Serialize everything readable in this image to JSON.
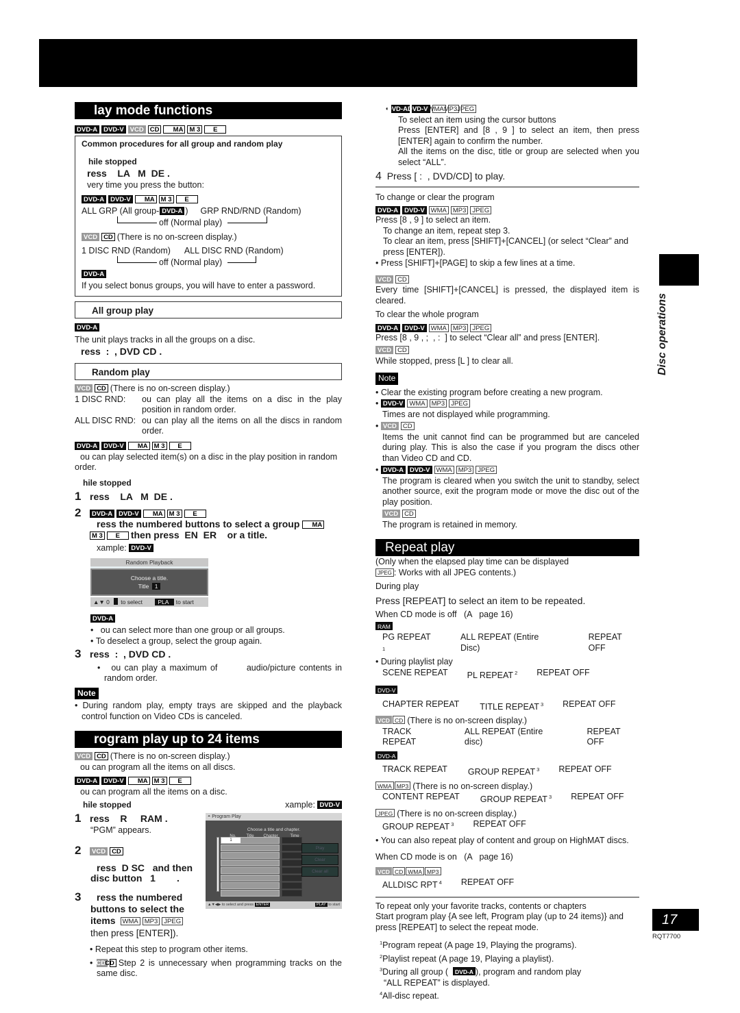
{
  "page": {
    "number": "17",
    "code": "RQT7700",
    "side_tab": "Disc operations"
  },
  "tags": {
    "dvda": "DVD-A",
    "dvdv": "DVD-V",
    "vcd": "VCD",
    "cd": "CD",
    "wma_trunc": "MA",
    "mp3_trunc": "M 3",
    "jpeg_trunc": "E",
    "wma": "WMA",
    "mp3": "MP3",
    "jpeg": "JPEG",
    "ram": "RAM"
  },
  "left": {
    "play_mode": {
      "title": "lay mode functions",
      "common_title": "Common procedures for all group and random play",
      "while_stopped": "hile stopped",
      "press_play_mode": "ress    LA   M  DE .",
      "every_time": "very time you press the button:",
      "seq1_a": "ALL GRP (All group-",
      "seq1_b": ")",
      "seq1_c": "GRP RND/RND (Random)",
      "seq1_off": "off (Normal play)",
      "vcd_no_display": "(There is no on-screen display.)",
      "seq2_a": "1 DISC RND (Random)",
      "seq2_b": "ALL DISC RND (Random)",
      "seq2_off": "off (Normal play)",
      "password_note": "If you select bonus groups, you will have to enter a password."
    },
    "all_group": {
      "title": "All group play",
      "desc": "The unit plays tracks in all the groups on a disc.",
      "press": "ress  :  , DVD CD ."
    },
    "random": {
      "title": "Random play",
      "vcd_no_display": "(There is no on-screen display.)",
      "disc1_key": "1 DISC RND:",
      "disc1_val": "ou can play all the items on a disc in the play position in random order.",
      "alldisc_key": "ALL DISC RND:",
      "alldisc_val": "ou can play all the items on all the discs in random order.",
      "selected_desc": "ou can play selected item(s) on a disc in the play position in random order.",
      "while_stopped": "hile stopped",
      "step1": "ress    LA   M  DE .",
      "step2_a": "ress the numbered buttons to select a group",
      "step2_b": "then press  EN  ER    or a title.",
      "example": "xample:",
      "screen_title": "Random Playback",
      "screen_prompt": "Choose a title.",
      "screen_field_label": "Title",
      "screen_field_value": "1",
      "screen_keys": "▲▼ 0",
      "screen_to_select": "to select",
      "screen_play": "PLA",
      "screen_to_start": "to start",
      "dvda_b1": "ou can select more than one group or all groups.",
      "dvda_b2": "To deselect a group, select the group again.",
      "step3": "ress  :  , DVD CD .",
      "step3_b1": "ou can play a maximum of        audio/picture contents in random order.",
      "note_label": "Note",
      "note_b1": "During random play, empty trays are skipped and the playback control function on Video CDs is canceled."
    },
    "program": {
      "title": "rogram play  up to 24 items",
      "vcd_no_display": "(There is no on-screen display.)",
      "vcd_desc": "ou can program all the items on all discs.",
      "dvd_desc": "ou can program all the items on a disc.",
      "while_stopped": "hile stopped",
      "example": "xample:",
      "step1": "ress    R     RAM .",
      "step1_sub": "“PGM” appears.",
      "step2_a": "ress  D SC   and then",
      "step2_b": "disc button   1        .",
      "step3_a": "ress the numbered",
      "step3_b": "buttons to select the",
      "step3_c": "items",
      "step3_d": "then press [ENTER]).",
      "b1": "Repeat this step to program other items.",
      "b2": "Step 2 is unnecessary when programming tracks on the same disc.",
      "screen": {
        "title": "Program Play",
        "prompt": "Choose a title and chapter.",
        "cols": [
          "No.",
          "Title",
          "Chapter",
          "Time"
        ],
        "first_no": "1",
        "buttons": [
          "Play",
          "Clear",
          "Clear all"
        ],
        "footer_left": "▲▼◀▶ to select and press",
        "footer_enter": "ENTER",
        "footer_play": "PLAY",
        "footer_right": "to start"
      }
    }
  },
  "right": {
    "cursor": {
      "l1": "To select an item using the cursor buttons",
      "l2": "Press [ENTER] and [8 , 9 ] to select an item, then press [ENTER] again to confirm the number.",
      "l3": "All the items on the disc, title or group are selected when you select “ALL”."
    },
    "step4_num": "4",
    "step4": "Press [ :  , DVD/CD] to play.",
    "change": {
      "heading": "To change or clear the program",
      "l1": "Press [8 , 9 ] to select an item.",
      "l2": "To change an item, repeat step 3.",
      "l3": "To clear an item, press [SHIFT]+[CANCEL] (or select “Clear” and press [ENTER]).",
      "b1": "Press [SHIFT]+[PAGE] to skip a few lines at a time.",
      "vcd_l1": "Every time [SHIFT]+[CANCEL] is pressed, the displayed item is cleared."
    },
    "clear_all": {
      "heading": "To clear the whole program",
      "l1": "Press [8 , 9 , ;  , :  ] to select “Clear all” and press [ENTER].",
      "vcd_l1": "While stopped, press [L ] to clear all."
    },
    "note": {
      "label": "Note",
      "b1": "Clear the existing program before creating a new program.",
      "b2": "Times are not displayed while programming.",
      "b3": "Items the unit cannot find can be programmed but are canceled during play. This is also the case if you program the discs other than Video CD and CD.",
      "b4": "The program is cleared when you switch the unit to standby, select another source, exit the program mode or move the disc out of the play position.",
      "b4_vcd": "The program is retained in memory."
    },
    "repeat": {
      "title": "Repeat play",
      "only_when": "(Only when the elapsed play time can be displayed",
      "jpeg_works": ": Works with all JPEG contents.)",
      "during_play": "During play",
      "press": "Press [REPEAT] to select an item to be repeated.",
      "cd_off": "When CD mode is off   (A   page 16)",
      "ram_seq": [
        "PG REPEAT",
        "ALL REPEAT (Entire Disc)",
        "REPEAT OFF"
      ],
      "ram_seq_sup": "1",
      "playlist_bullet": "During playlist play",
      "playlist_seq": [
        "SCENE REPEAT",
        "PL REPEAT",
        "REPEAT OFF"
      ],
      "playlist_sup": "2",
      "dvdv_seq": [
        "CHAPTER REPEAT",
        "TITLE REPEAT",
        "REPEAT OFF"
      ],
      "dvdv_sup": "3",
      "vcd_no_display": "(There is no on-screen display.)",
      "vcd_seq": [
        "TRACK REPEAT",
        "ALL REPEAT (Entire disc)",
        "REPEAT OFF"
      ],
      "dvda_seq": [
        "TRACK REPEAT",
        "GROUP REPEAT",
        "REPEAT OFF"
      ],
      "dvda_sup": "3",
      "wma_no_display": "(There is no on-screen display.)",
      "wma_seq": [
        "CONTENT REPEAT",
        "GROUP REPEAT",
        "REPEAT OFF"
      ],
      "wma_sup": "3",
      "jpeg_no_display": "(There is no on-screen display.)",
      "jpeg_seq": [
        "GROUP REPEAT",
        "REPEAT OFF"
      ],
      "jpeg_sup": "3",
      "highmat": "You can also repeat play of content and group on HighMAT discs.",
      "cd_on": "When CD mode is on   (A   page 16)",
      "alldisc_seq": [
        "ALLDISC RPT",
        "REPEAT OFF"
      ],
      "alldisc_sup": "4",
      "fav_heading": "To repeat only your favorite tracks, contents or chapters",
      "fav_body": "Start program play {A   see left, Program play (up to 24 items)} and press [REPEAT] to select the repeat mode.",
      "fn1": "Program repeat (A   page 19, Playing the programs).",
      "fn2": "Playlist repeat (A   page 19, Playing a playlist).",
      "fn3_a": "During all group (",
      "fn3_b": "), program and random play",
      "fn3_c": "“ALL REPEAT” is displayed.",
      "fn4": "All-disc repeat."
    }
  }
}
